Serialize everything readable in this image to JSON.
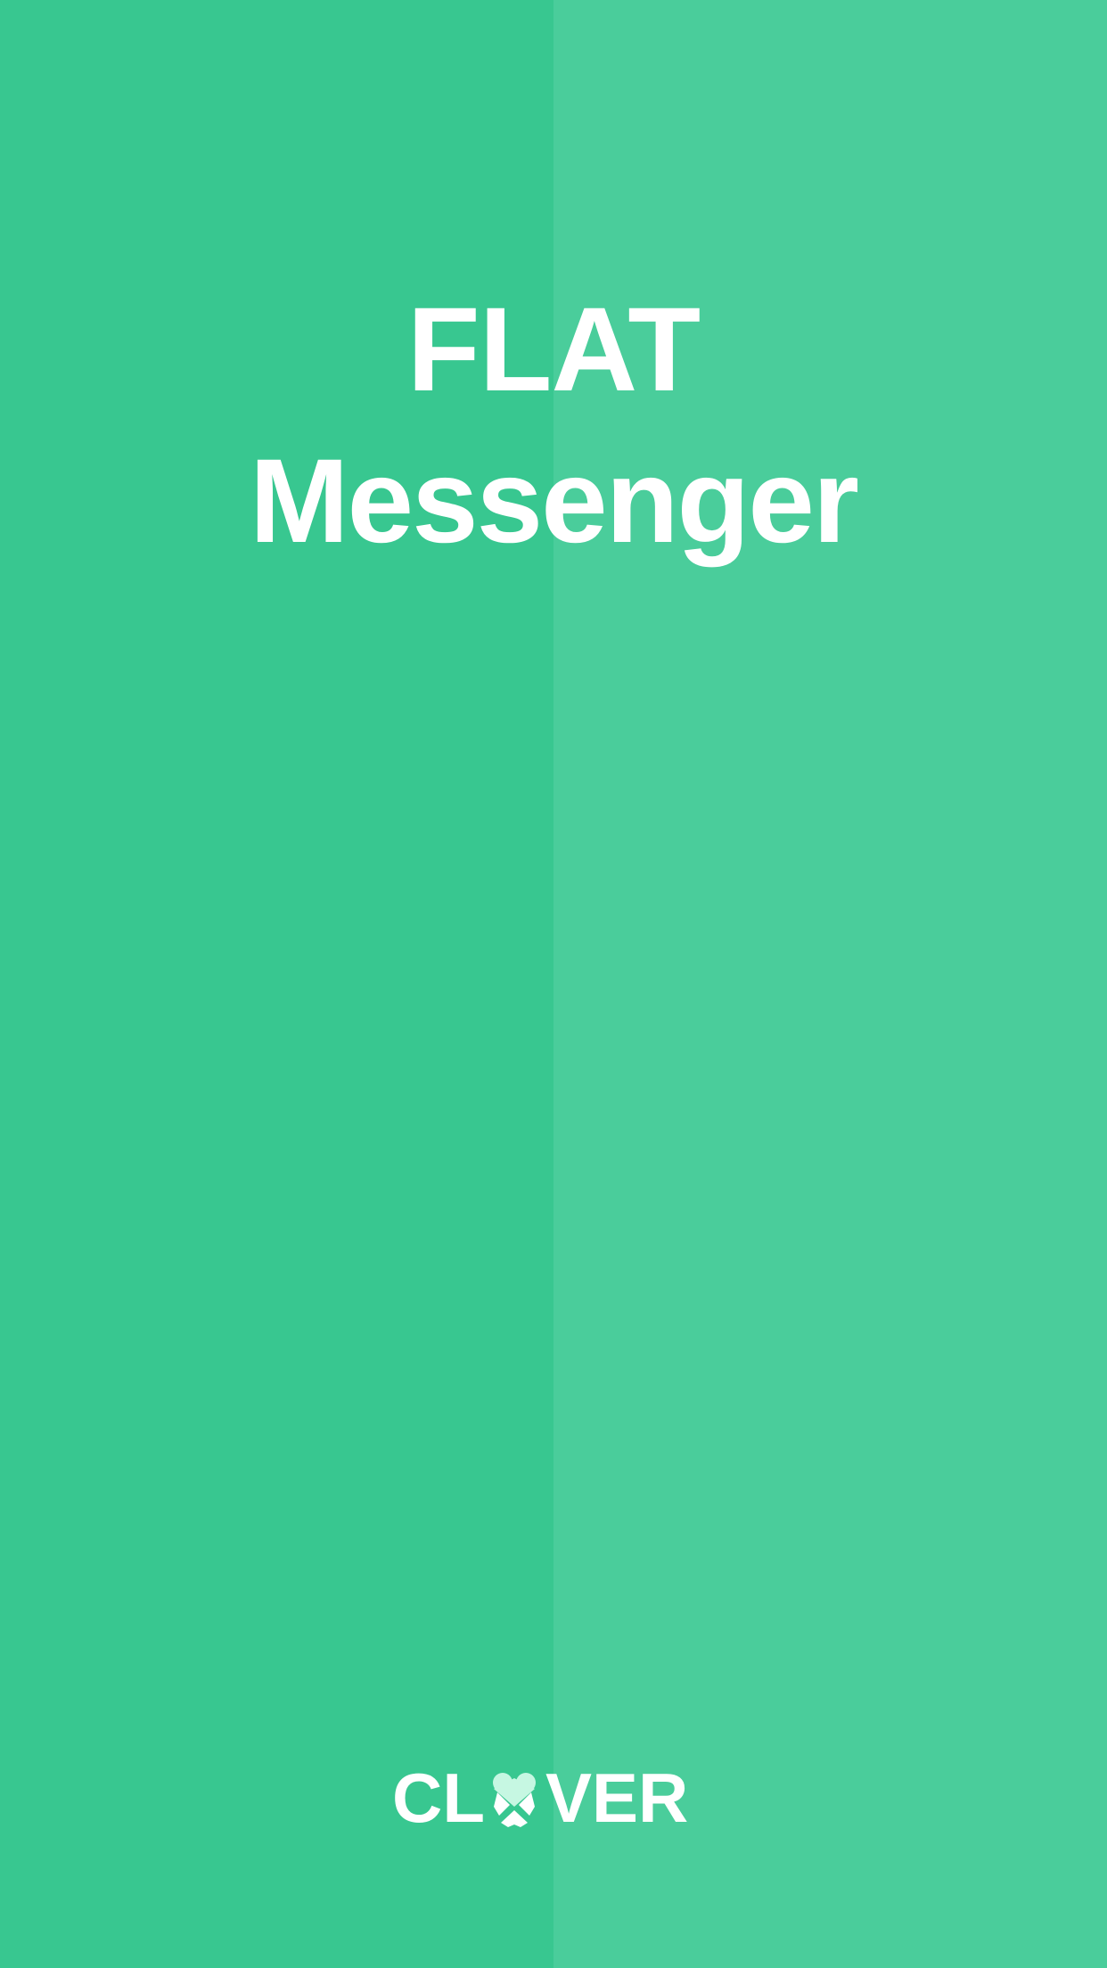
{
  "splash": {
    "title_line1": "FLAT",
    "title_line2": "Messenger"
  },
  "brand": {
    "left": "CL",
    "right": "VER",
    "icon": "clover-icon"
  },
  "colors": {
    "background_left": "#38c790",
    "background_right": "#4acd9b",
    "text": "#ffffff",
    "icon_accent": "#c6f7e2"
  }
}
